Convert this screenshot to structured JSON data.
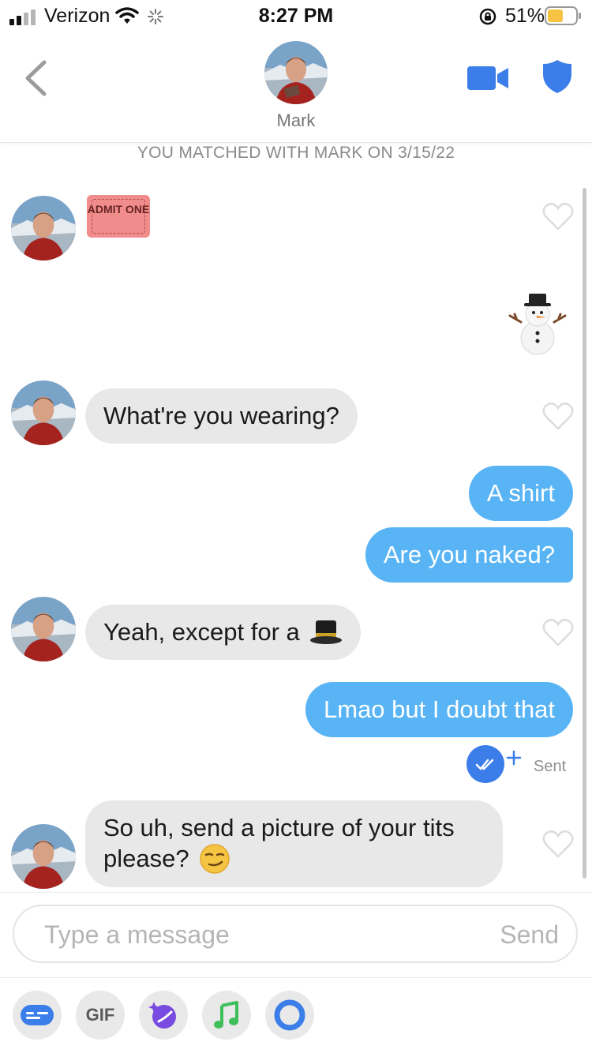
{
  "status_bar": {
    "carrier": "Verizon",
    "time": "8:27 PM",
    "battery": "51%"
  },
  "header": {
    "name": "Mark"
  },
  "match_notice": "YOU MATCHED WITH MARK ON 3/15/22",
  "messages": [
    {
      "from": "them",
      "kind": "sticker",
      "text": "ADMIT ONE"
    },
    {
      "from": "me",
      "kind": "emoji",
      "icon": "snowman-emoji"
    },
    {
      "from": "them",
      "kind": "text",
      "text": "What're you wearing?"
    },
    {
      "from": "me",
      "kind": "text",
      "text": "A shirt"
    },
    {
      "from": "me",
      "kind": "text",
      "text": "Are you naked?"
    },
    {
      "from": "them",
      "kind": "text",
      "text": "Yeah, except for a",
      "icon": "top-hat-emoji"
    },
    {
      "from": "me",
      "kind": "text",
      "text": "Lmao but I doubt that"
    },
    {
      "from": "them",
      "kind": "text",
      "text_line1": "So uh, send a picture of your tits",
      "text_line2": "please?",
      "icon": "smirk-emoji"
    }
  ],
  "receipt": {
    "label": "Sent"
  },
  "composer": {
    "placeholder": "Type a message",
    "send_label": "Send"
  },
  "tray": {
    "gif_label": "GIF"
  },
  "colors": {
    "accent_blue": "#58b4f5",
    "bubble_gray": "#e8e8e8",
    "icon_blue": "#3b7de9"
  }
}
